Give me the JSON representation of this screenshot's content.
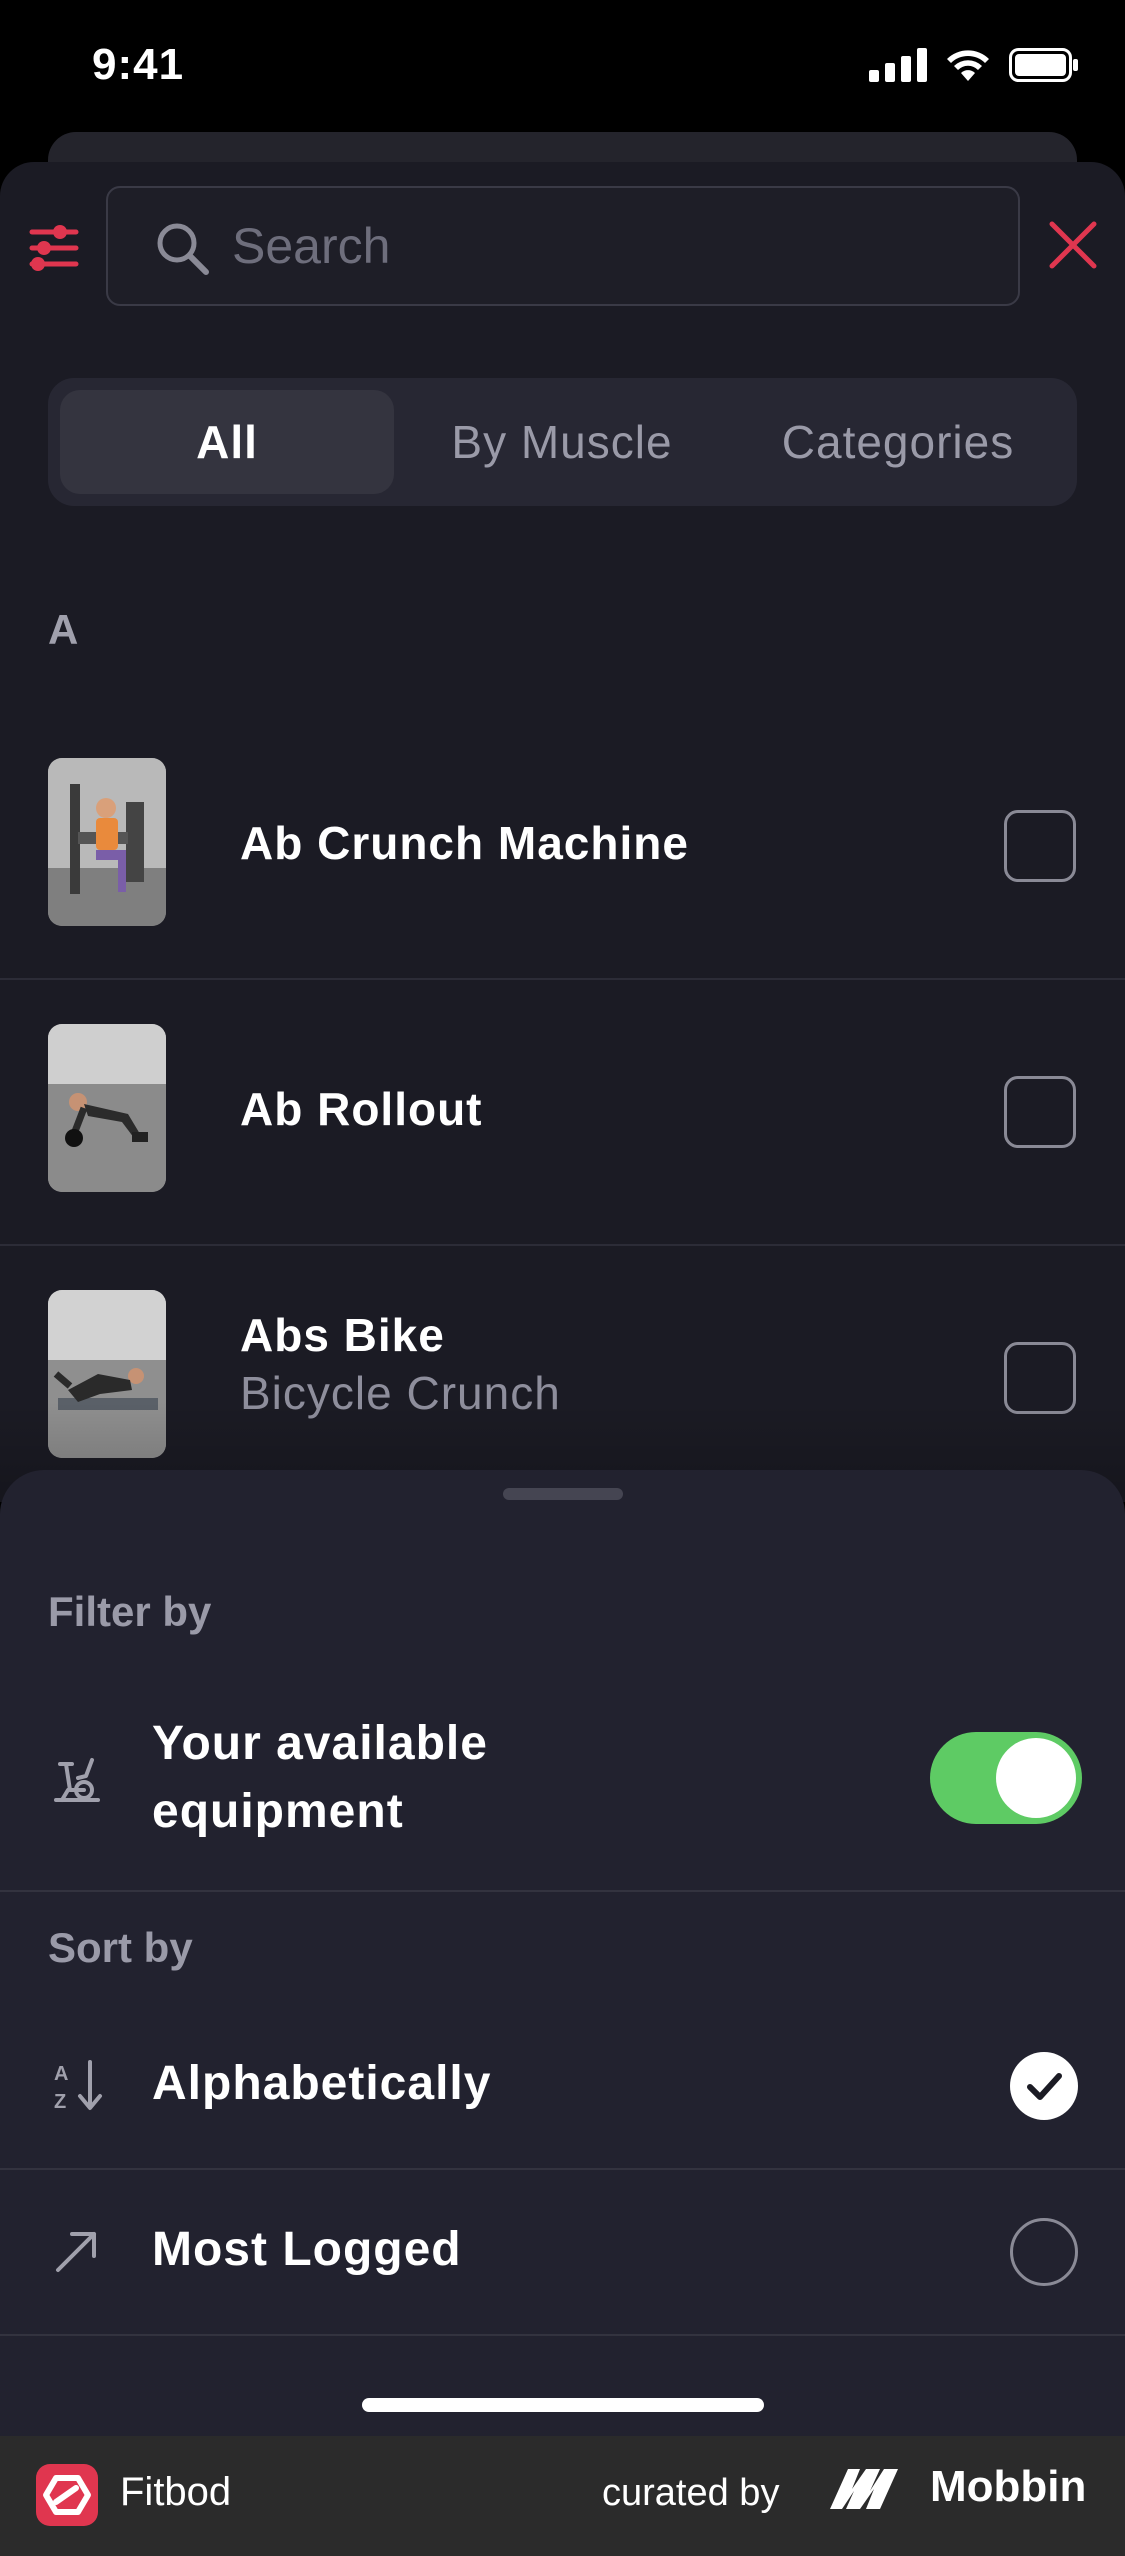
{
  "status_bar": {
    "time": "9:41"
  },
  "search": {
    "placeholder": "Search"
  },
  "tabs": [
    {
      "label": "All",
      "active": true
    },
    {
      "label": "By Muscle",
      "active": false
    },
    {
      "label": "Categories",
      "active": false
    }
  ],
  "section": {
    "letter": "A"
  },
  "exercises": [
    {
      "title": "Ab Crunch Machine",
      "subtitle": "",
      "checked": false,
      "thumb_icon": "machine-exercise-photo"
    },
    {
      "title": "Ab Rollout",
      "subtitle": "",
      "checked": false,
      "thumb_icon": "rollout-exercise-photo"
    },
    {
      "title": "Abs Bike",
      "subtitle": "Bicycle Crunch",
      "checked": false,
      "thumb_icon": "floor-exercise-photo"
    }
  ],
  "bottom_sheet": {
    "filter_label": "Filter by",
    "equipment_line1": "Your available",
    "equipment_line2": "equipment",
    "equipment_toggle": true,
    "sort_label": "Sort by",
    "sort_options": [
      {
        "label": "Alphabetically",
        "selected": true,
        "icon": "sort-az-icon"
      },
      {
        "label": "Most Logged",
        "selected": false,
        "icon": "trending-arrow-icon"
      }
    ]
  },
  "footer": {
    "app_name": "Fitbod",
    "curated_by": "curated by",
    "brand": "Mobbin"
  },
  "colors": {
    "accent": "#e0364f",
    "toggle_on": "#5ecb64",
    "background": "#1b1b24",
    "sheet": "#22222f"
  }
}
